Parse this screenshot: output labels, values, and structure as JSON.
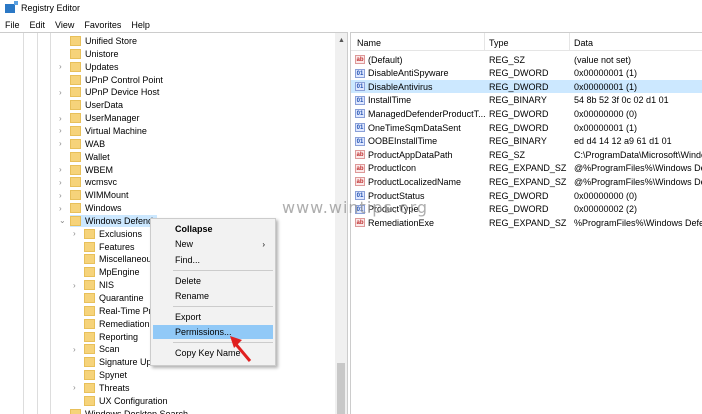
{
  "window": {
    "title": "Registry Editor"
  },
  "menu": [
    "File",
    "Edit",
    "View",
    "Favorites",
    "Help"
  ],
  "tree": [
    {
      "label": "Unified Store",
      "level": 1,
      "expandable": false
    },
    {
      "label": "Unistore",
      "level": 1,
      "expandable": false
    },
    {
      "label": "Updates",
      "level": 1,
      "expandable": true
    },
    {
      "label": "UPnP Control Point",
      "level": 1,
      "expandable": false
    },
    {
      "label": "UPnP Device Host",
      "level": 1,
      "expandable": true
    },
    {
      "label": "UserData",
      "level": 1,
      "expandable": false
    },
    {
      "label": "UserManager",
      "level": 1,
      "expandable": true
    },
    {
      "label": "Virtual Machine",
      "level": 1,
      "expandable": true
    },
    {
      "label": "WAB",
      "level": 1,
      "expandable": true
    },
    {
      "label": "Wallet",
      "level": 1,
      "expandable": false
    },
    {
      "label": "WBEM",
      "level": 1,
      "expandable": true
    },
    {
      "label": "wcmsvc",
      "level": 1,
      "expandable": true
    },
    {
      "label": "WIMMount",
      "level": 1,
      "expandable": true
    },
    {
      "label": "Windows",
      "level": 1,
      "expandable": true
    },
    {
      "label": "Windows Defend",
      "level": 1,
      "expandable": true,
      "expanded": true,
      "selected": true
    },
    {
      "label": "Exclusions",
      "level": 2,
      "expandable": true
    },
    {
      "label": "Features",
      "level": 2,
      "expandable": false
    },
    {
      "label": "Miscellaneou",
      "level": 2,
      "expandable": false
    },
    {
      "label": "MpEngine",
      "level": 2,
      "expandable": false
    },
    {
      "label": "NIS",
      "level": 2,
      "expandable": true
    },
    {
      "label": "Quarantine",
      "level": 2,
      "expandable": false
    },
    {
      "label": "Real-Time Pro",
      "level": 2,
      "expandable": false
    },
    {
      "label": "Remediation",
      "level": 2,
      "expandable": false
    },
    {
      "label": "Reporting",
      "level": 2,
      "expandable": false
    },
    {
      "label": "Scan",
      "level": 2,
      "expandable": true
    },
    {
      "label": "Signature Updates",
      "level": 2,
      "expandable": false
    },
    {
      "label": "Spynet",
      "level": 2,
      "expandable": false
    },
    {
      "label": "Threats",
      "level": 2,
      "expandable": true
    },
    {
      "label": "UX Configuration",
      "level": 2,
      "expandable": false
    },
    {
      "label": "Windows Desktop Search",
      "level": 1,
      "expandable": false
    }
  ],
  "values": {
    "columns": {
      "name": "Name",
      "type": "Type",
      "data": "Data"
    },
    "rows": [
      {
        "name": "(Default)",
        "type": "REG_SZ",
        "data": "(value not set)",
        "icon": "string"
      },
      {
        "name": "DisableAntiSpyware",
        "type": "REG_DWORD",
        "data": "0x00000001 (1)",
        "icon": "binary"
      },
      {
        "name": "DisableAntivirus",
        "type": "REG_DWORD",
        "data": "0x00000001 (1)",
        "icon": "binary",
        "selected": true
      },
      {
        "name": "InstallTime",
        "type": "REG_BINARY",
        "data": "54 8b 52 3f 0c 02 d1 01",
        "icon": "binary"
      },
      {
        "name": "ManagedDefenderProductT...",
        "type": "REG_DWORD",
        "data": "0x00000000 (0)",
        "icon": "binary"
      },
      {
        "name": "OneTimeSqmDataSent",
        "type": "REG_DWORD",
        "data": "0x00000001 (1)",
        "icon": "binary"
      },
      {
        "name": "OOBEInstallTime",
        "type": "REG_BINARY",
        "data": "ed d4 14 12 a9 61 d1 01",
        "icon": "binary"
      },
      {
        "name": "ProductAppDataPath",
        "type": "REG_SZ",
        "data": "C:\\ProgramData\\Microsoft\\Windo",
        "icon": "string"
      },
      {
        "name": "ProductIcon",
        "type": "REG_EXPAND_SZ",
        "data": "@%ProgramFiles%\\Windows Defe",
        "icon": "string"
      },
      {
        "name": "ProductLocalizedName",
        "type": "REG_EXPAND_SZ",
        "data": "@%ProgramFiles%\\Windows Defe",
        "icon": "string"
      },
      {
        "name": "ProductStatus",
        "type": "REG_DWORD",
        "data": "0x00000000 (0)",
        "icon": "binary"
      },
      {
        "name": "ProductType",
        "type": "REG_DWORD",
        "data": "0x00000002 (2)",
        "icon": "binary"
      },
      {
        "name": "RemediationExe",
        "type": "REG_EXPAND_SZ",
        "data": "%ProgramFiles%\\Windows Defen",
        "icon": "string"
      }
    ]
  },
  "context_menu": {
    "collapse": "Collapse",
    "new": "New",
    "find": "Find...",
    "delete": "Delete",
    "rename": "Rename",
    "export": "Export",
    "permissions": "Permissions...",
    "copy_key_name": "Copy Key Name"
  },
  "watermark": "www.wintips.org",
  "colors": {
    "selection": "#cce8ff",
    "menu_highlight": "#91c9f7",
    "arrow": "#e02020"
  }
}
